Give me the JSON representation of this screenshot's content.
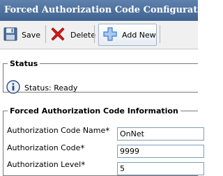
{
  "header": {
    "title": "Forced Authorization Code Configuration"
  },
  "toolbar": {
    "save_label": "Save",
    "delete_label": "Delete",
    "add_new_label": "Add New",
    "icons": {
      "save": "floppy-disk-icon",
      "delete": "red-x-icon",
      "add_new": "blue-plus-icon"
    }
  },
  "status": {
    "legend": "Status",
    "text": "Status: Ready",
    "icon": "info-icon"
  },
  "info": {
    "legend": "Forced Authorization Code Information",
    "fields": [
      {
        "label": "Authorization Code Name",
        "required": "*",
        "value": "OnNet"
      },
      {
        "label": "Authorization Code",
        "required": "*",
        "value": "9999"
      },
      {
        "label": "Authorization Level",
        "required": "*",
        "value": "5"
      }
    ]
  },
  "colors": {
    "title_bar": "#4a6d9a",
    "delete_x": "#d01a1a",
    "add_plus": "#3d7cc9",
    "info_icon": "#2a4f86"
  }
}
